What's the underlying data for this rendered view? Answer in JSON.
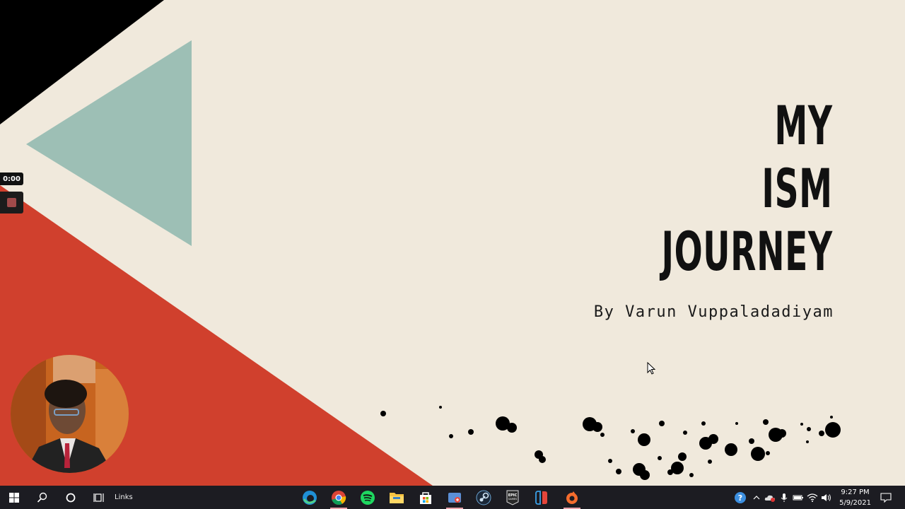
{
  "slide": {
    "title_lines": [
      "MY",
      "ISM",
      "JOURNEY"
    ],
    "subtitle": "By Varun Vuppaladadiyam",
    "colors": {
      "background": "#f0e9dc",
      "red": "#d0402d",
      "teal": "#9dbfb5",
      "black": "#000000"
    }
  },
  "recorder": {
    "time": "0:00",
    "stop_icon": "stop-icon"
  },
  "webcam": {
    "description_icon": "webcam-feed"
  },
  "taskbar": {
    "links_label": "Links",
    "apps": [
      "edge-icon",
      "chrome-icon",
      "spotify-icon",
      "file-explorer-icon",
      "store-icon",
      "photos-icon",
      "steam-icon",
      "epic-games-icon",
      "nintendo-switch-icon",
      "origin-icon"
    ],
    "clock": {
      "time": "9:27 PM",
      "date": "5/9/2021"
    }
  }
}
